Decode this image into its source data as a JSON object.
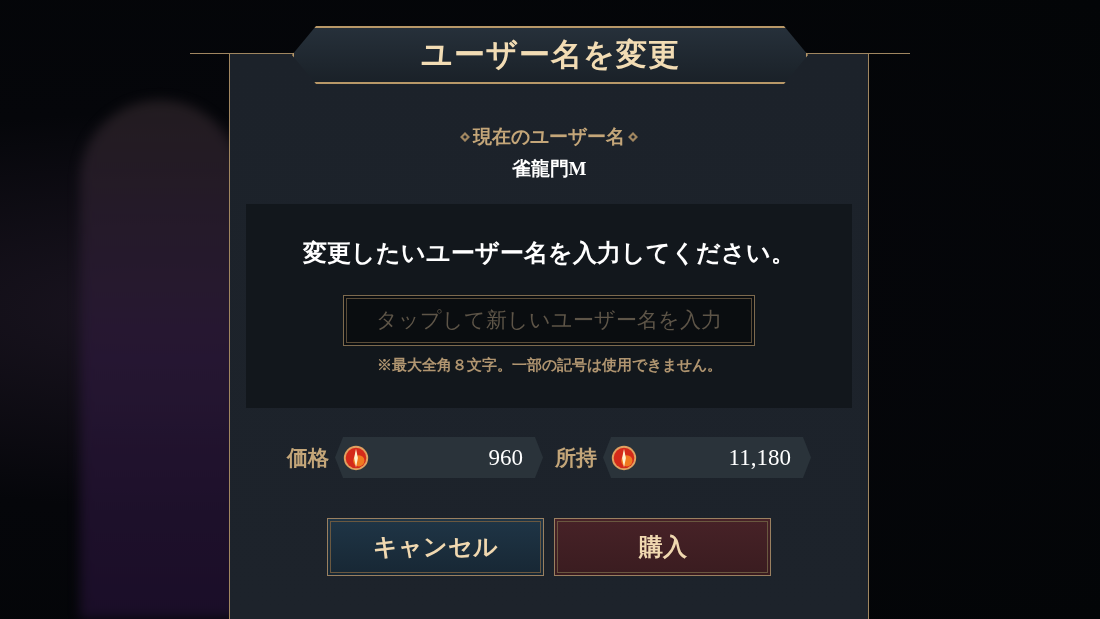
{
  "dialog": {
    "title": "ユーザー名を変更",
    "current_label": "現在のユーザー名",
    "current_name": "雀龍門M",
    "prompt": "変更したいユーザー名を入力してください。",
    "name_field": {
      "placeholder": "タップして新しいユーザー名を入力"
    },
    "note": "※最大全角８文字。一部の記号は使用できません。",
    "amounts": [
      {
        "label": "価格",
        "value": "960"
      },
      {
        "label": "所持",
        "value": "11,180"
      }
    ],
    "buttons": [
      {
        "label": "キャンセル",
        "kind": "cancel"
      },
      {
        "label": "購入",
        "kind": "buy"
      }
    ]
  }
}
